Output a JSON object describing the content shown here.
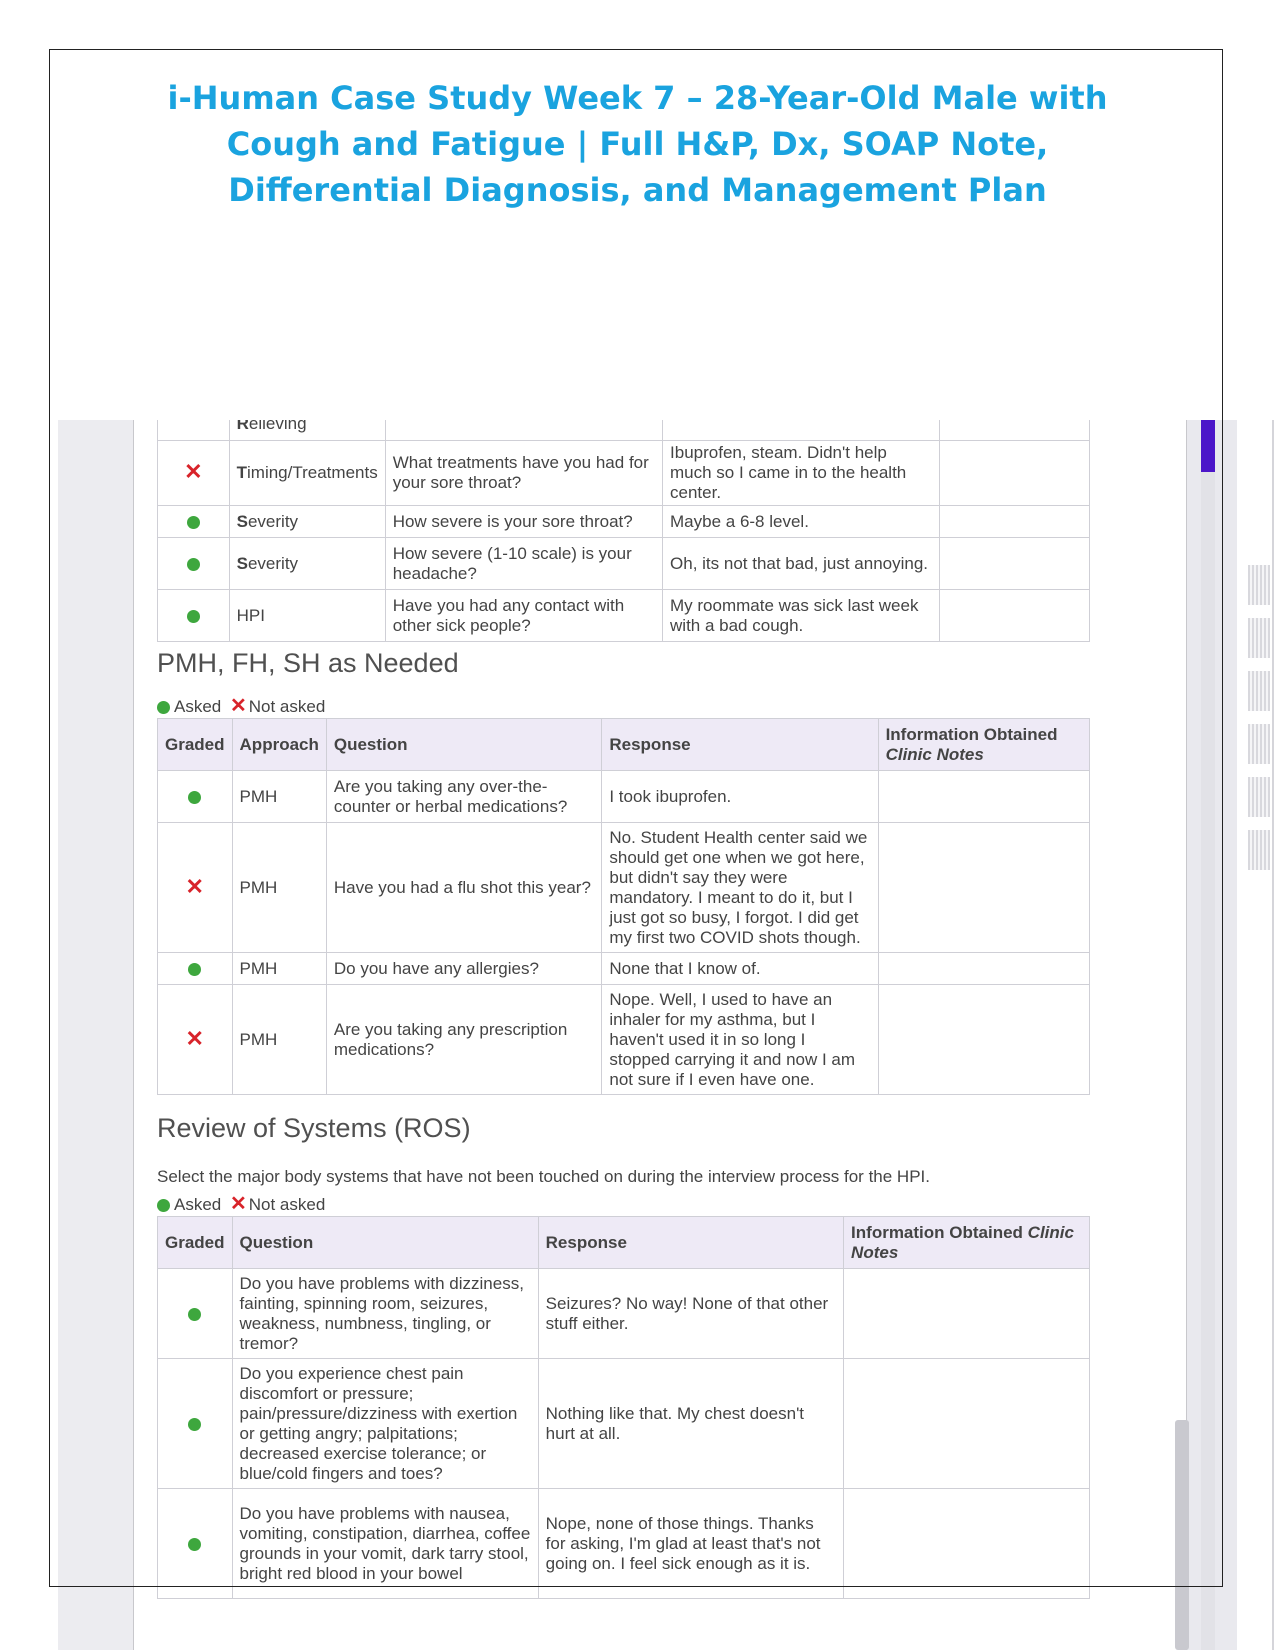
{
  "document": {
    "title": "i-Human Case Study Week 7 – 28-Year-Old Male with Cough and Fatigue | Full H&P, Dx, SOAP Note, Differential Diagnosis, and Management Plan"
  },
  "legend": {
    "asked": "Asked",
    "not_asked": "Not asked"
  },
  "colors": {
    "asked": "#3ea73e",
    "not_asked": "#d8232a",
    "title": "#1aa3df",
    "header_bg": "#eeeaf6"
  },
  "hpi_table": {
    "rows": [
      {
        "graded": "",
        "element_first": "R",
        "element_rest": "elieving",
        "question": "",
        "response": "",
        "notes": ""
      },
      {
        "graded": "not_asked",
        "element_first": "T",
        "element_rest": "iming/Treatments",
        "question": "What treatments have you had for your sore throat?",
        "response": "Ibuprofen, steam. Didn't help much so I came in to the health center.",
        "notes": ""
      },
      {
        "graded": "asked",
        "element_first": "S",
        "element_rest": "everity",
        "question": "How severe is your sore throat?",
        "response": "Maybe a 6-8 level.",
        "notes": ""
      },
      {
        "graded": "asked",
        "element_first": "S",
        "element_rest": "everity",
        "question": "How severe (1-10 scale) is your headache?",
        "response": "Oh, its not that bad, just annoying.",
        "notes": ""
      },
      {
        "graded": "asked",
        "element_first": "",
        "element_rest": "HPI",
        "question": "Have you had any contact with other sick people?",
        "response": "My roommate was sick last week with a bad cough.",
        "notes": ""
      }
    ]
  },
  "pmh_section": {
    "heading": "PMH, FH, SH as Needed",
    "headers": {
      "graded": "Graded",
      "approach": "Approach",
      "question": "Question",
      "response": "Response",
      "info": "Information Obtained",
      "clinic_notes": "Clinic Notes"
    },
    "rows": [
      {
        "graded": "asked",
        "approach": "PMH",
        "question": "Are you taking any over-the-counter or herbal medications?",
        "response": "I took ibuprofen.",
        "notes": ""
      },
      {
        "graded": "not_asked",
        "approach": "PMH",
        "question": "Have you had a flu shot this year?",
        "response": "No. Student Health center said we should get one when we got here, but didn't say they were mandatory. I meant to do it, but I just got so busy, I forgot. I did get my first two COVID shots though.",
        "notes": ""
      },
      {
        "graded": "asked",
        "approach": "PMH",
        "question": "Do you have any allergies?",
        "response": "None that I know of.",
        "notes": ""
      },
      {
        "graded": "not_asked",
        "approach": "PMH",
        "question": "Are you taking any prescription medications?",
        "response": "Nope. Well, I used to have an inhaler for my asthma, but I haven't used it in so long I stopped carrying it and now I am not sure if I even have one.",
        "notes": ""
      }
    ]
  },
  "ros_section": {
    "heading": "Review of Systems (ROS)",
    "instruction": "Select the major body systems that have not been touched on during the interview process for the HPI.",
    "headers": {
      "graded": "Graded",
      "question": "Question",
      "response": "Response",
      "info": "Information Obtained",
      "clinic_notes": "Clinic Notes"
    },
    "rows": [
      {
        "graded": "asked",
        "question": "Do you have problems with dizziness, fainting, spinning room, seizures, weakness, numbness, tingling, or tremor?",
        "response": "Seizures? No way! None of that other stuff either.",
        "notes": ""
      },
      {
        "graded": "asked",
        "question": "Do you experience chest pain discomfort or pressure; pain/pressure/dizziness with exertion or getting angry; palpitations; decreased exercise tolerance; or blue/cold fingers and toes?",
        "response": "Nothing like that. My chest doesn't hurt at all.",
        "notes": ""
      },
      {
        "graded": "asked",
        "question": "Do you have problems with nausea, vomiting, constipation, diarrhea, coffee grounds in your vomit, dark tarry stool, bright red blood in your bowel",
        "response": "Nope, none of those things. Thanks for asking, I'm glad at least that's not going on. I feel sick enough as it is.",
        "notes": ""
      }
    ]
  }
}
